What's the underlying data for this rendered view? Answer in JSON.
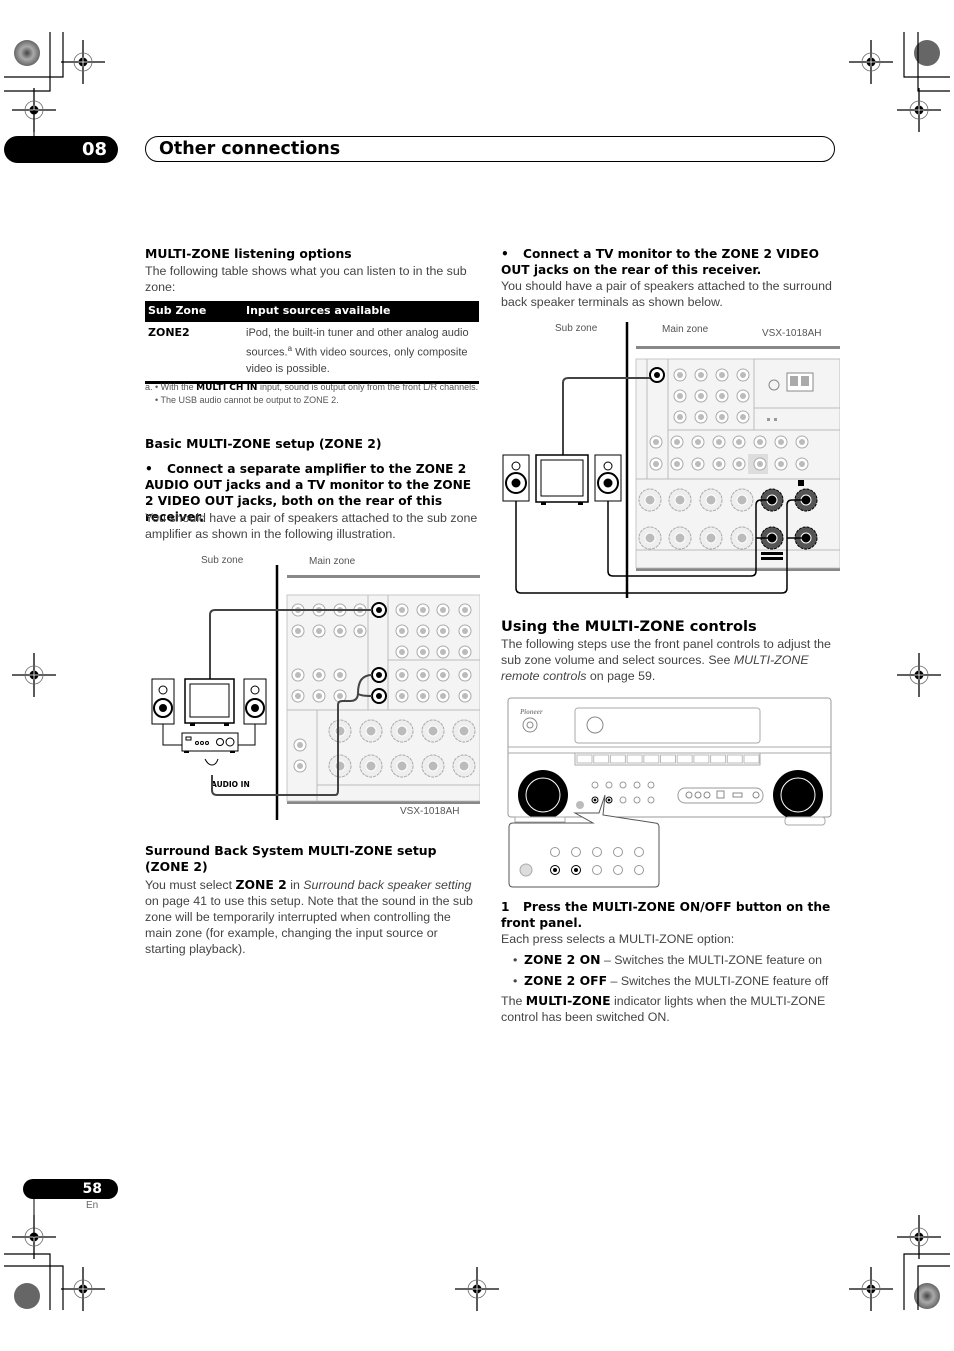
{
  "header": {
    "chapter_number": "08",
    "chapter_title": "Other connections"
  },
  "left_column": {
    "section1": {
      "heading": "MULTI-ZONE listening options",
      "intro": "The following table shows what you can listen to in the sub zone:",
      "table": {
        "headers": [
          "Sub Zone",
          "Input sources available"
        ],
        "rows": [
          {
            "zone": "ZONE2",
            "sources_part1": "iPod, the built-in tuner and other analog audio sources.",
            "footnote_ref": "a",
            "sources_part2": " With video sources, only composite video is possible."
          }
        ]
      },
      "footnote": {
        "marker": "a. • With the ",
        "bold": "MULTI CH IN",
        "rest": " input, sound is output only from the front L/R channels.",
        "line2": "• The USB audio cannot be output to ZONE 2."
      }
    },
    "section2": {
      "heading": "Basic MULTI-ZONE setup (ZONE 2)",
      "instruction": "Connect a separate amplifier to the ZONE 2 AUDIO OUT jacks and a TV monitor to the ZONE 2 VIDEO OUT jacks, both on the rear of this receiver.",
      "body": "You should have a pair of speakers attached to the sub zone amplifier as shown in the following illustration.",
      "diagram": {
        "sub_zone_label": "Sub zone",
        "main_zone_label": "Main zone",
        "audio_in_label": "AUDIO IN",
        "model_label": "VSX-1018AH"
      }
    },
    "section3": {
      "heading": "Surround Back System MULTI-ZONE setup (ZONE 2)",
      "body_pre": "You must select ",
      "body_bold": "ZONE 2",
      "body_mid": " in ",
      "body_italic": "Surround back speaker setting",
      "body_post": " on page 41 to use this setup. Note that the sound in the sub zone will be temporarily interrupted when controlling the main zone (for example, changing the input source or starting playback)."
    }
  },
  "right_column": {
    "section1": {
      "instruction": "Connect a TV monitor to the ZONE 2 VIDEO OUT jacks on the rear of this receiver.",
      "body": "You should have a pair of speakers attached to the surround back speaker terminals as shown below.",
      "diagram": {
        "sub_zone_label": "Sub zone",
        "main_zone_label": "Main zone",
        "model_label": "VSX-1018AH"
      }
    },
    "section2": {
      "heading": "Using the MULTI-ZONE controls",
      "body_pre": "The following steps use the front panel controls to adjust the sub zone volume and select sources. See ",
      "body_italic": "MULTI-ZONE remote controls",
      "body_post": " on page 59.",
      "step1": {
        "number": "1",
        "text": "Press the MULTI-ZONE ON/OFF button on the front panel.",
        "body": "Each press selects a MULTI-ZONE option:",
        "options": [
          {
            "bold": "ZONE 2 ON",
            "text": " – Switches the MULTI-ZONE feature on"
          },
          {
            "bold": "ZONE 2 OFF",
            "text": " – Switches the MULTI-ZONE feature off"
          }
        ],
        "note_pre": "The ",
        "note_bold": "MULTI-ZONE",
        "note_post": " indicator lights when the MULTI-ZONE control has been switched ON."
      }
    }
  },
  "footer": {
    "page_number": "58",
    "language": "En"
  }
}
